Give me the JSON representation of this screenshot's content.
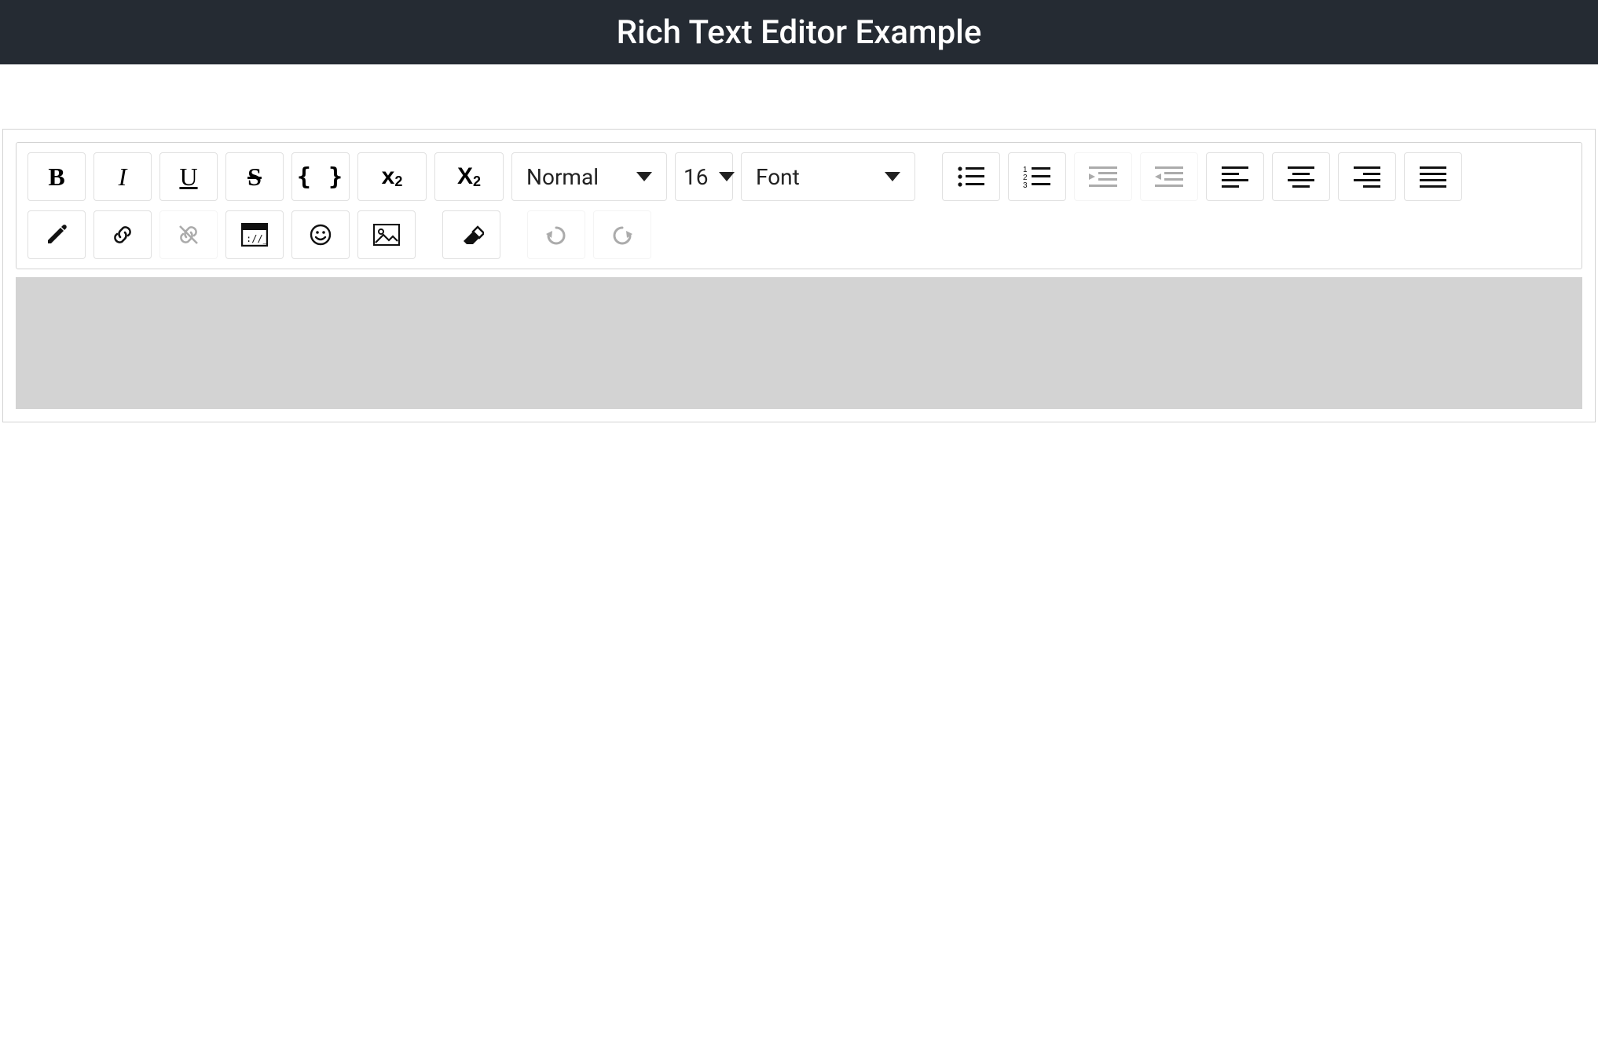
{
  "header": {
    "title": "Rich Text Editor Example"
  },
  "toolbar": {
    "format": {
      "selected": "Normal"
    },
    "fontSize": {
      "selected": "16"
    },
    "fontFamily": {
      "selected": "Font"
    },
    "icons": {
      "bold": "B",
      "italic": "I",
      "underline": "U",
      "strike": "S",
      "code": "{ }",
      "sup_base": "x",
      "sup_exp": "2",
      "sub_base": "X",
      "sub_exp": "2"
    },
    "states": {
      "unlink_disabled": true,
      "indent_disabled": true,
      "outdent_disabled": true,
      "undo_disabled": true,
      "redo_disabled": true
    }
  }
}
